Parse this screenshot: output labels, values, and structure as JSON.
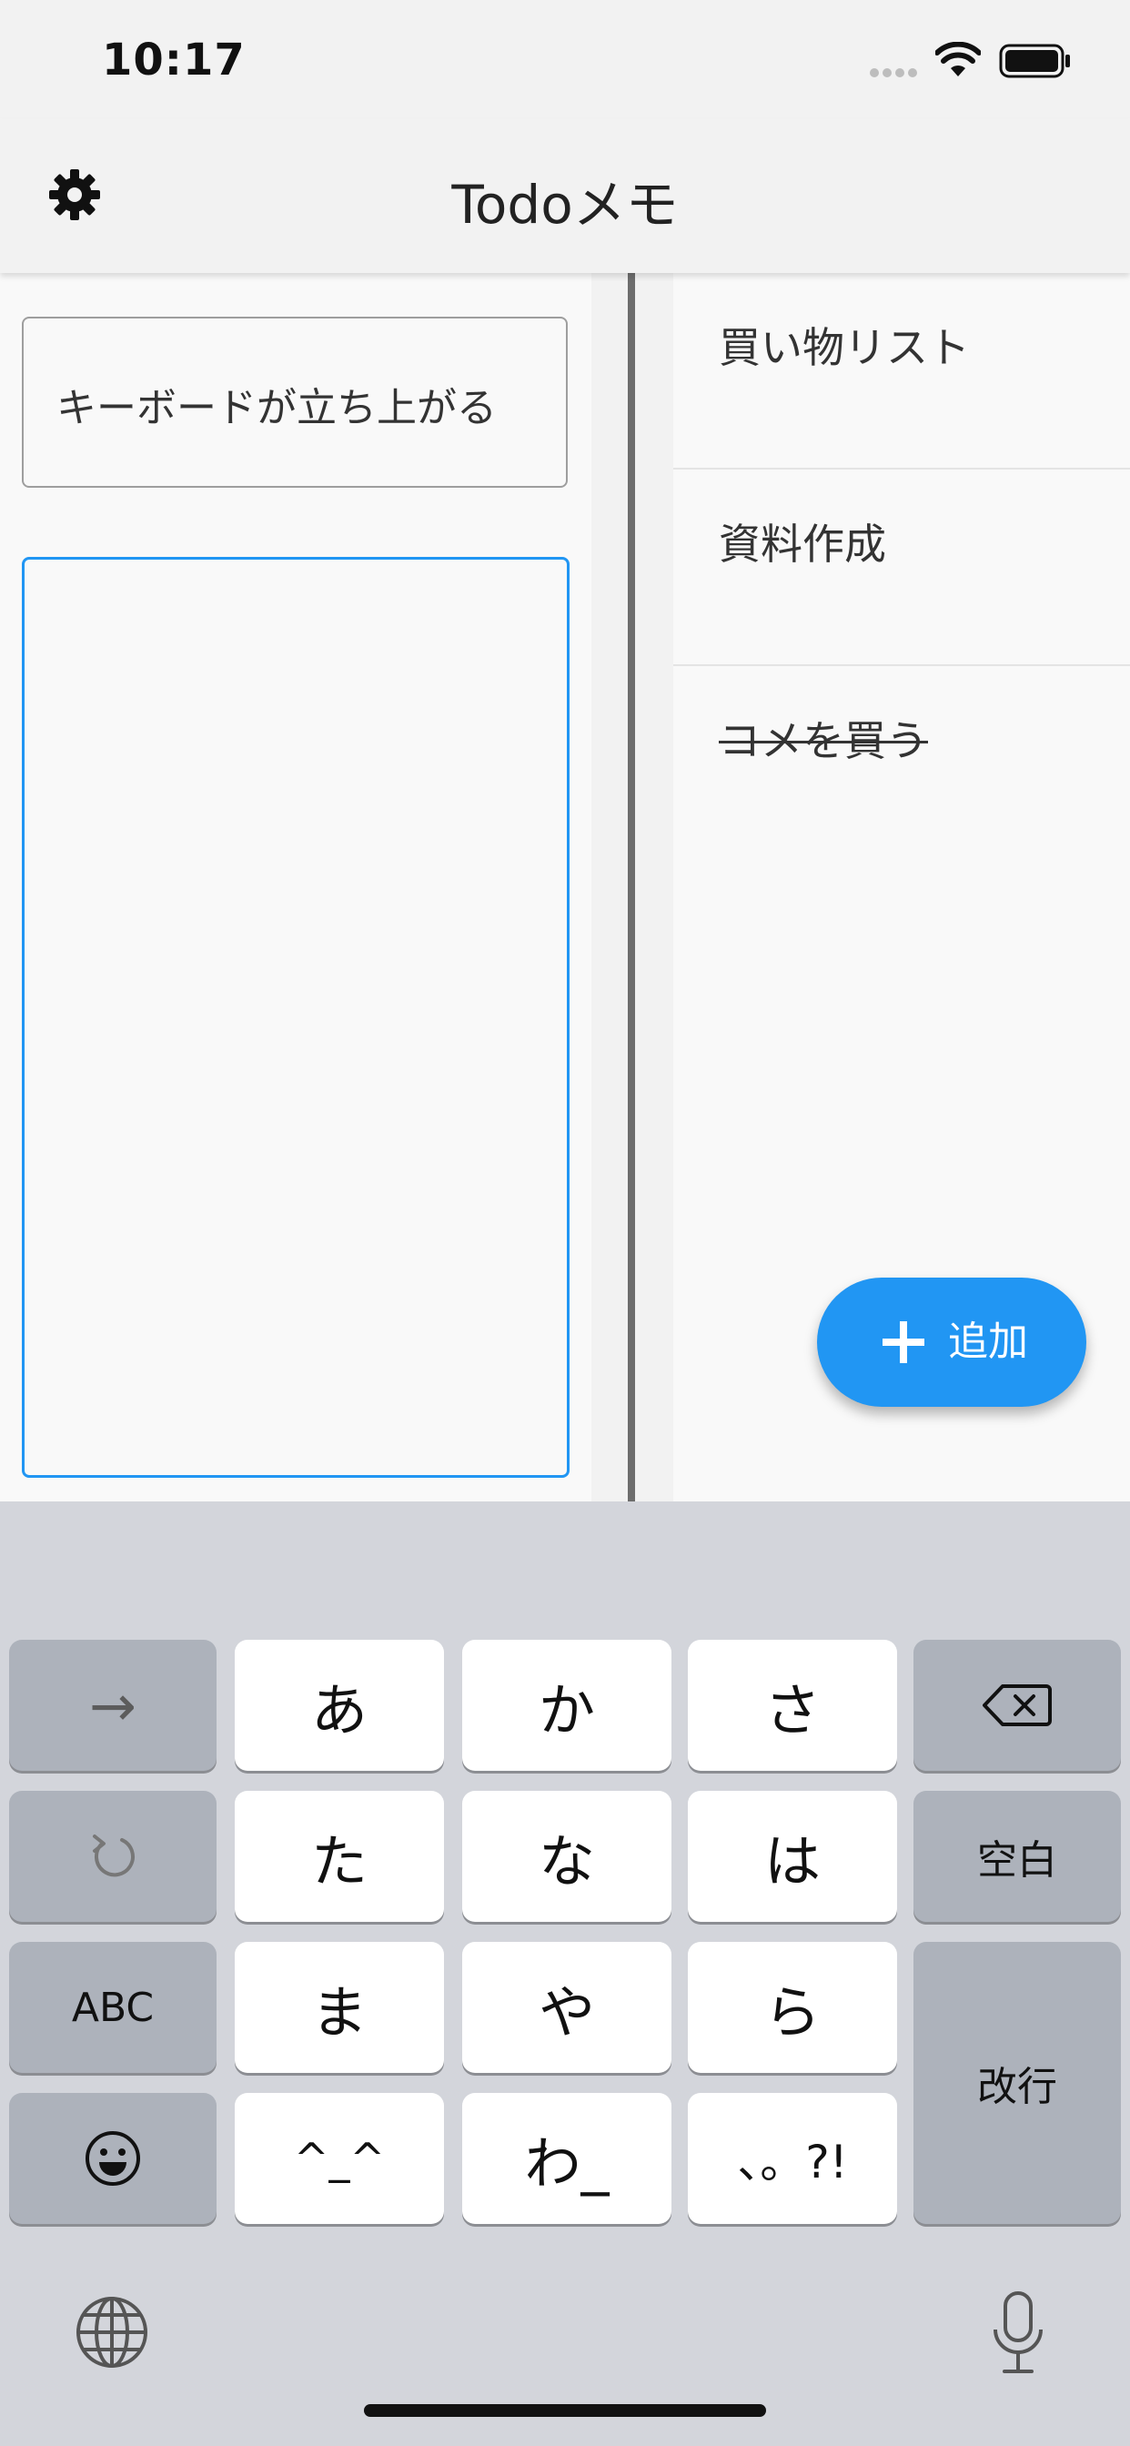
{
  "status_bar": {
    "time": "10:17"
  },
  "app_bar": {
    "title": "Todoメモ"
  },
  "editor": {
    "title_value": "キーボードが立ち上がる",
    "body_value": ""
  },
  "todos": [
    {
      "label": "買い物リスト",
      "done": false
    },
    {
      "label": "資料作成",
      "done": false
    },
    {
      "label": "コメを買う",
      "done": true
    }
  ],
  "fab": {
    "label": "追加"
  },
  "keyboard": {
    "keys": {
      "arrow": "→",
      "a": "あ",
      "ka": "か",
      "sa": "さ",
      "ta": "た",
      "na": "な",
      "ha": "は",
      "space": "空白",
      "abc": "ABC",
      "ma": "ま",
      "ya": "や",
      "ra": "ら",
      "enter": "改行",
      "kao": "^_^",
      "wa": "わ_",
      "punct": "、。?!"
    }
  },
  "colors": {
    "accent": "#2196f3",
    "keyboard_bg": "#d3d5db",
    "divider": "#6d6d6d"
  }
}
